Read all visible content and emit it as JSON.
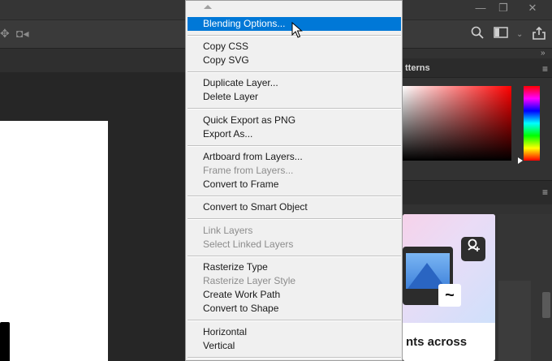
{
  "window": {
    "minimize_glyph": "—",
    "restore_glyph": "❐",
    "close_glyph": "✕"
  },
  "options_bar": {
    "icons": [
      "transform-3d-icon",
      "video-camera-icon"
    ],
    "right_icons": [
      "search-icon",
      "workspace-icon",
      "chevron-down-icon",
      "share-icon"
    ]
  },
  "panels": {
    "tab_label": "tterns",
    "learn_card_title": "nts across"
  },
  "colors": {
    "highlight": "#0078d7",
    "menu_bg": "#f0f0f0",
    "app_bg": "#282828"
  },
  "context_menu": {
    "items": [
      {
        "label": "Blending Options...",
        "state": "highlighted"
      },
      {
        "label": "Copy CSS",
        "state": "enabled"
      },
      {
        "label": "Copy SVG",
        "state": "enabled"
      },
      {
        "label": "Duplicate Layer...",
        "state": "enabled"
      },
      {
        "label": "Delete Layer",
        "state": "enabled"
      },
      {
        "label": "Quick Export as PNG",
        "state": "enabled"
      },
      {
        "label": "Export As...",
        "state": "enabled"
      },
      {
        "label": "Artboard from Layers...",
        "state": "enabled"
      },
      {
        "label": "Frame from Layers...",
        "state": "disabled"
      },
      {
        "label": "Convert to Frame",
        "state": "enabled"
      },
      {
        "label": "Convert to Smart Object",
        "state": "enabled"
      },
      {
        "label": "Link Layers",
        "state": "disabled"
      },
      {
        "label": "Select Linked Layers",
        "state": "disabled"
      },
      {
        "label": "Rasterize Type",
        "state": "enabled"
      },
      {
        "label": "Rasterize Layer Style",
        "state": "disabled"
      },
      {
        "label": "Create Work Path",
        "state": "enabled"
      },
      {
        "label": "Convert to Shape",
        "state": "enabled"
      },
      {
        "label": "Horizontal",
        "state": "enabled"
      },
      {
        "label": "Vertical",
        "state": "enabled"
      }
    ]
  }
}
